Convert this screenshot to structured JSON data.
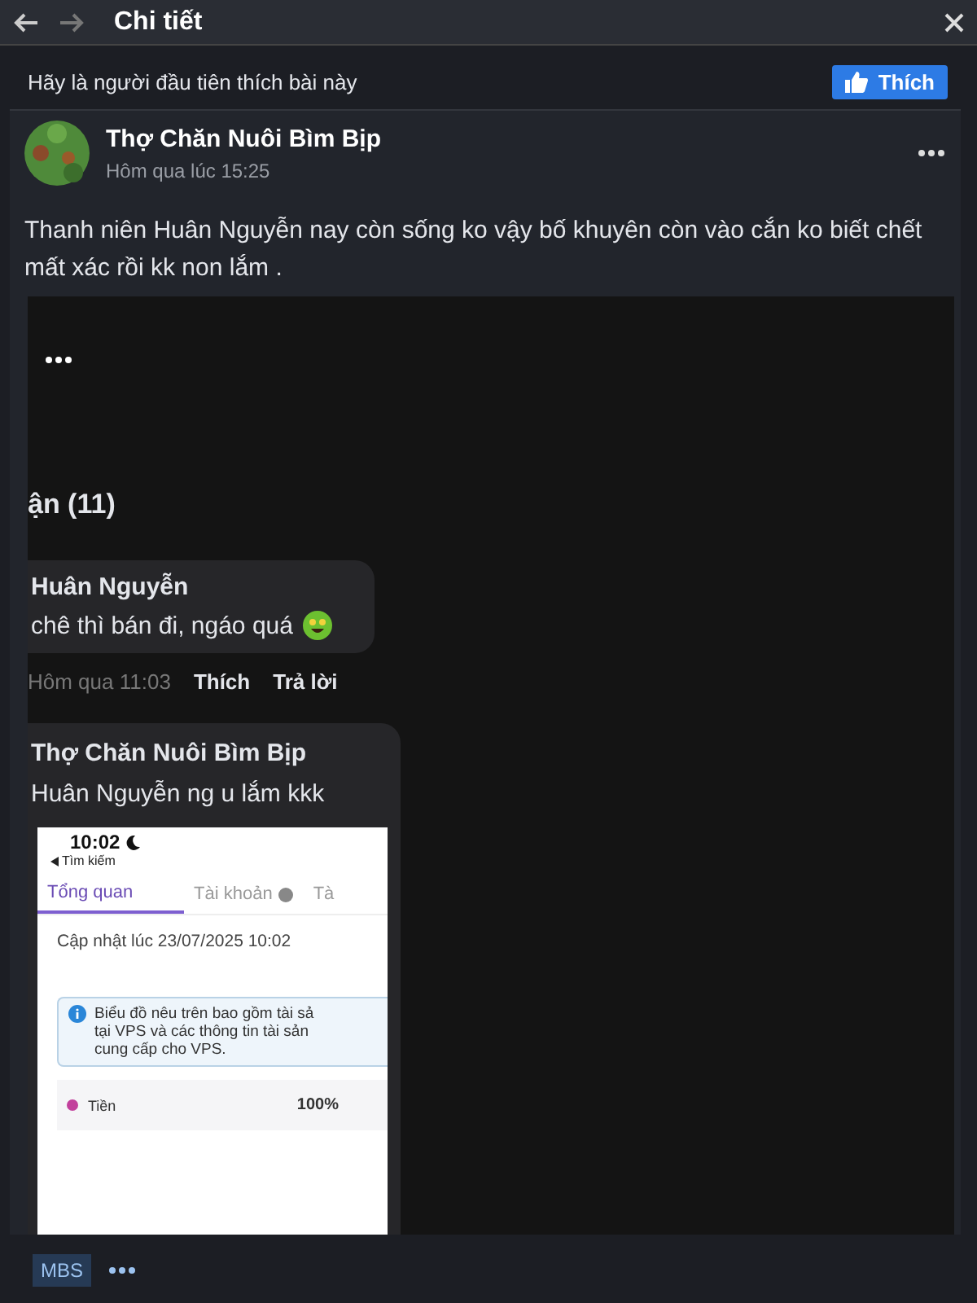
{
  "header": {
    "title": "Chi tiết"
  },
  "like_bar": {
    "text": "Hãy là người đầu tiên thích bài này",
    "button": "Thích"
  },
  "post": {
    "author": "Thợ Chăn Nuôi Bìm Bịp",
    "time": "Hôm qua lúc 15:25",
    "text": "Thanh niên Huân Nguyễn nay còn sống ko vậy bố khuyên còn vào cắn ko biết chết mất xác rồi kk non lắm ."
  },
  "attachment": {
    "section_title": "ận (11)",
    "comment": {
      "author": "Huân Nguyễn",
      "text": "chê thì bán đi, ngáo quá",
      "time": "Hôm qua 11:03",
      "like": "Thích",
      "reply": "Trả lời"
    },
    "reply": {
      "author": "Thợ Chăn Nuôi Bìm Bịp",
      "text": "Huân Nguyễn ng u lắm kkk",
      "screenshot": {
        "clock": "10:02",
        "back_link": "Tìm kiếm",
        "tabs": [
          {
            "label": "Tổng quan",
            "selected": true
          },
          {
            "label": "Tài khoản",
            "selected": false
          },
          {
            "label": "Tà",
            "selected": false
          }
        ],
        "updated": "Cập nhật lúc 23/07/2025 10:02",
        "notice": [
          "Biểu đồ nêu trên bao gồm tài sả",
          "tại VPS và các thông tin tài sản",
          "cung cấp cho VPS."
        ],
        "legend": [
          {
            "label": "Tiền",
            "value": "100%",
            "color": "#c2409c"
          }
        ]
      }
    }
  },
  "footer": {
    "tags": [
      "MBS"
    ]
  }
}
